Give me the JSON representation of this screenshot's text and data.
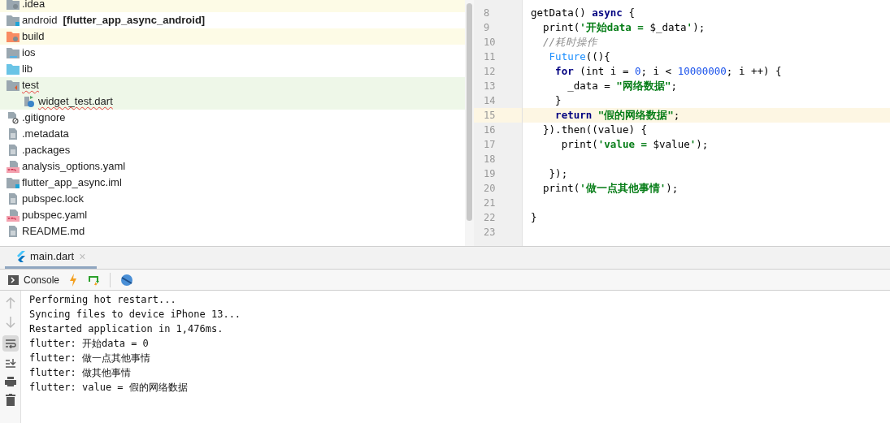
{
  "project_tree": [
    {
      "label": ".idea",
      "kind": "folder-excluded",
      "excluded": true,
      "test": false
    },
    {
      "label": "android",
      "suffix": "[flutter_app_async_android]",
      "kind": "folder-module",
      "excluded": false,
      "test": false
    },
    {
      "label": "build",
      "kind": "folder-build",
      "excluded": true,
      "test": false
    },
    {
      "label": "ios",
      "kind": "folder-ios",
      "excluded": false,
      "test": false
    },
    {
      "label": "lib",
      "kind": "folder-source",
      "excluded": false,
      "test": false
    },
    {
      "label": "test",
      "kind": "folder-test",
      "excluded": false,
      "test": true,
      "spell_error": true,
      "children": [
        {
          "label": "widget_test.dart",
          "kind": "dart-test",
          "excluded": false,
          "test": true,
          "spell_error": true
        }
      ]
    },
    {
      "label": ".gitignore",
      "kind": "ignore-file",
      "excluded": false,
      "test": false
    },
    {
      "label": ".metadata",
      "kind": "text-file",
      "excluded": false,
      "test": false
    },
    {
      "label": ".packages",
      "kind": "text-file",
      "excluded": false,
      "test": false
    },
    {
      "label": "analysis_options.yaml",
      "kind": "yaml-file",
      "excluded": false,
      "test": false
    },
    {
      "label": "flutter_app_async.iml",
      "kind": "module-file",
      "excluded": false,
      "test": false
    },
    {
      "label": "pubspec.lock",
      "kind": "text-file",
      "excluded": false,
      "test": false
    },
    {
      "label": "pubspec.yaml",
      "kind": "yaml-file",
      "excluded": false,
      "test": false
    },
    {
      "label": "README.md",
      "kind": "text-file",
      "excluded": false,
      "test": false
    }
  ],
  "editor": {
    "lines": [
      {
        "number": "8",
        "current": false,
        "tokens": [
          {
            "kind": "plain",
            "text": "getData() "
          },
          {
            "kind": "keyword",
            "text": "async"
          },
          {
            "kind": "plain",
            "text": " {"
          }
        ]
      },
      {
        "number": "9",
        "current": false,
        "tokens": [
          {
            "kind": "plain",
            "text": "  print("
          },
          {
            "kind": "string",
            "text": "'开始data = "
          },
          {
            "kind": "plain",
            "text": "$_data"
          },
          {
            "kind": "string",
            "text": "'"
          },
          {
            "kind": "plain",
            "text": ");"
          }
        ]
      },
      {
        "number": "10",
        "current": false,
        "tokens": [
          {
            "kind": "comment",
            "text": "  //耗时操作"
          }
        ]
      },
      {
        "number": "11",
        "current": false,
        "tokens": [
          {
            "kind": "call",
            "text": "   Future"
          },
          {
            "kind": "plain",
            "text": "((){"
          }
        ]
      },
      {
        "number": "12",
        "current": false,
        "tokens": [
          {
            "kind": "keyword",
            "text": "    for"
          },
          {
            "kind": "plain",
            "text": " (int i = "
          },
          {
            "kind": "number",
            "text": "0"
          },
          {
            "kind": "plain",
            "text": "; i < "
          },
          {
            "kind": "number",
            "text": "10000000"
          },
          {
            "kind": "plain",
            "text": "; i ++) {"
          }
        ]
      },
      {
        "number": "13",
        "current": false,
        "tokens": [
          {
            "kind": "plain",
            "text": "      _data = "
          },
          {
            "kind": "string",
            "text": "\"网络数据\""
          },
          {
            "kind": "plain",
            "text": ";"
          }
        ]
      },
      {
        "number": "14",
        "current": false,
        "tokens": [
          {
            "kind": "plain",
            "text": "    }"
          }
        ]
      },
      {
        "number": "15",
        "current": true,
        "tokens": [
          {
            "kind": "keyword",
            "text": "    return"
          },
          {
            "kind": "string",
            "text": " \"假的网络数据\""
          },
          {
            "kind": "plain",
            "text": ";"
          }
        ]
      },
      {
        "number": "16",
        "current": false,
        "tokens": [
          {
            "kind": "plain",
            "text": "  }).then((value) {"
          }
        ]
      },
      {
        "number": "17",
        "current": false,
        "tokens": [
          {
            "kind": "plain",
            "text": "     print("
          },
          {
            "kind": "string",
            "text": "'value = "
          },
          {
            "kind": "plain",
            "text": "$value"
          },
          {
            "kind": "string",
            "text": "'"
          },
          {
            "kind": "plain",
            "text": ");"
          }
        ]
      },
      {
        "number": "18",
        "current": false
      },
      {
        "number": "19",
        "current": false,
        "tokens": [
          {
            "kind": "plain",
            "text": "   });"
          }
        ]
      },
      {
        "number": "20",
        "current": false,
        "tokens": [
          {
            "kind": "plain",
            "text": "  print("
          },
          {
            "kind": "string",
            "text": "'做一点其他事情'"
          },
          {
            "kind": "plain",
            "text": ");"
          }
        ]
      },
      {
        "number": "21",
        "current": false
      },
      {
        "number": "22",
        "current": false,
        "tokens": [
          {
            "kind": "plain",
            "text": "}"
          }
        ]
      },
      {
        "number": "23",
        "current": false
      }
    ]
  },
  "run_tabs": [
    {
      "label": "main.dart",
      "selected": true,
      "close": "×"
    }
  ],
  "toolbar": {
    "console_label": "Console"
  },
  "console": {
    "lines": [
      "Performing hot restart...",
      "Syncing files to device iPhone 13...",
      "Restarted application in 1,476ms.",
      "flutter: 开始data = 0",
      "flutter: 做一点其他事情",
      "flutter: 做其他事情",
      "flutter: value = 假的网络数据"
    ],
    "soft_wrap": true
  }
}
